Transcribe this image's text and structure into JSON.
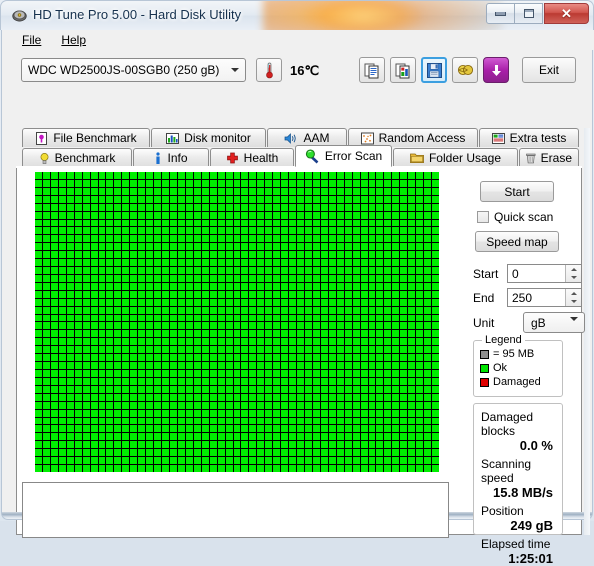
{
  "window": {
    "title": "HD Tune Pro 5.00 - Hard Disk Utility",
    "icon": "hard-disk-icon",
    "minimize_label": "–",
    "maximize_label": "□",
    "close_label": "✕"
  },
  "menu": {
    "items": [
      {
        "label": "File"
      },
      {
        "label": "Help"
      }
    ]
  },
  "toolbar": {
    "drive_selected": "WDC WD2500JS-00SGB0 (250 gB)",
    "temperature": "16℃",
    "thermometer_icon": "thermometer-icon",
    "buttons": [
      {
        "name": "copy-text-button",
        "icon": "copy-text-icon"
      },
      {
        "name": "copy-image-button",
        "icon": "copy-image-icon"
      },
      {
        "name": "save-button",
        "icon": "floppy-save-icon"
      },
      {
        "name": "options-button",
        "icon": "globe-icon"
      },
      {
        "name": "download-button",
        "icon": "down-arrow-icon"
      }
    ],
    "exit_label": "Exit"
  },
  "tabs": {
    "row1": [
      {
        "label": "File Benchmark",
        "icon": "file-benchmark-icon",
        "selected": false
      },
      {
        "label": "Disk monitor",
        "icon": "bar-chart-icon",
        "selected": false
      },
      {
        "label": "AAM",
        "icon": "speaker-icon",
        "selected": false
      },
      {
        "label": "Random Access",
        "icon": "random-access-icon",
        "selected": false
      },
      {
        "label": "Extra tests",
        "icon": "extra-tests-icon",
        "selected": false
      }
    ],
    "row2": [
      {
        "label": "Benchmark",
        "icon": "bulb-icon",
        "selected": false
      },
      {
        "label": "Info",
        "icon": "info-icon",
        "selected": false
      },
      {
        "label": "Health",
        "icon": "red-cross-icon",
        "selected": false
      },
      {
        "label": "Error Scan",
        "icon": "magnifier-icon",
        "selected": true
      },
      {
        "label": "Folder Usage",
        "icon": "folder-icon",
        "selected": false
      },
      {
        "label": "Erase",
        "icon": "trash-icon",
        "selected": false
      }
    ]
  },
  "panel": {
    "start_label": "Start",
    "quick_scan_label": "Quick scan",
    "quick_scan_checked": false,
    "speed_map_label": "Speed map",
    "start_field_label": "Start",
    "start_field_value": "0",
    "end_field_label": "End",
    "end_field_value": "250",
    "unit_label": "Unit",
    "unit_value": "gB"
  },
  "legend": {
    "title": "Legend",
    "block_size_label": "= 95 MB",
    "ok_label": "Ok",
    "damaged_label": "Damaged",
    "block_color": "#8f8f8f",
    "ok_color": "#00e400",
    "damaged_color": "#e00000"
  },
  "stats": {
    "damaged_blocks_label": "Damaged blocks",
    "damaged_blocks_value": "0.0 %",
    "scanning_speed_label": "Scanning speed",
    "scanning_speed_value": "15.8 MB/s",
    "position_label": "Position",
    "position_value": "249 gB",
    "elapsed_time_label": "Elapsed time",
    "elapsed_time_value": "1:25:01"
  },
  "scan_map": {
    "columns": 51,
    "rows": 38,
    "cell_state": "ok",
    "ok_color": "#00ee00",
    "background_color": "#000000"
  },
  "log": {
    "text": ""
  }
}
